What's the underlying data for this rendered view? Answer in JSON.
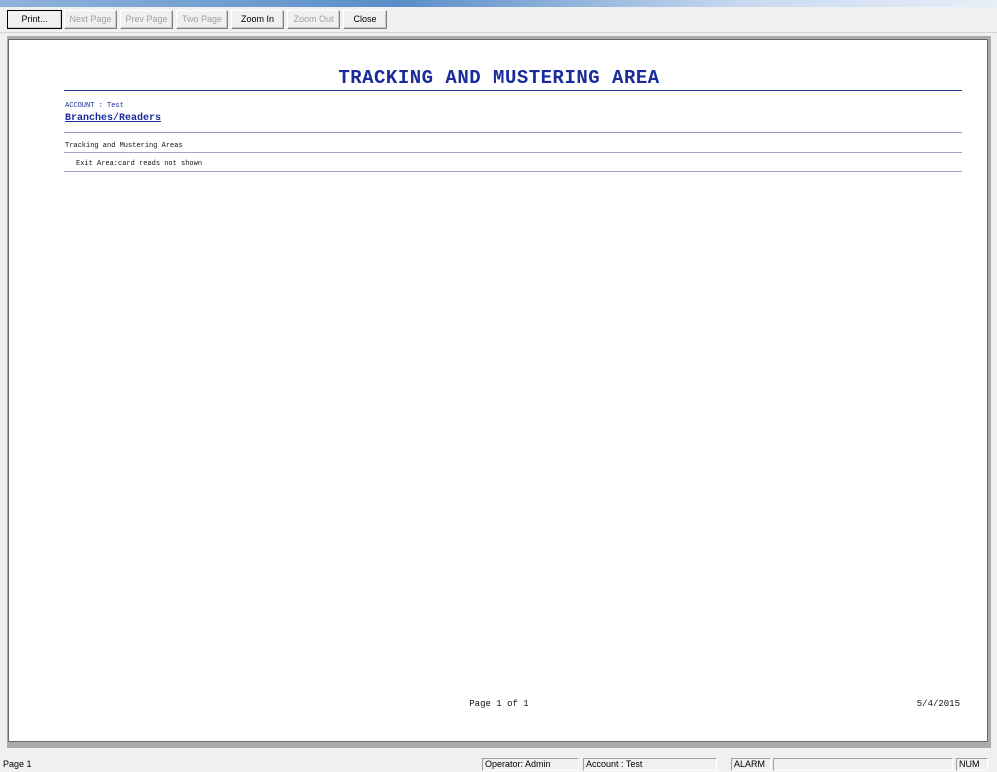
{
  "toolbar": {
    "print": "Print...",
    "next_page": "Next Page",
    "prev_page": "Prev Page",
    "two_page": "Two Page",
    "zoom_in": "Zoom In",
    "zoom_out": "Zoom Out",
    "close": "Close"
  },
  "report": {
    "title": "TRACKING AND MUSTERING AREA",
    "account_line": "ACCOUNT : Test",
    "section_heading": "Branches/Readers",
    "group_heading": "Tracking and Mustering Areas",
    "item": "Exit Area:card reads not shown",
    "page_footer": "Page 1 of 1",
    "date": "5/4/2015"
  },
  "statusbar": {
    "page": "Page 1",
    "operator": "Operator: Admin",
    "account": "Account : Test",
    "alarm": "ALARM",
    "blank": "",
    "num": "NUM"
  },
  "colors": {
    "report_text": "#1a2c9a",
    "page_bg": "#ffffff",
    "frame_bg": "#ababab",
    "chrome_bg": "#f0f0f0"
  }
}
